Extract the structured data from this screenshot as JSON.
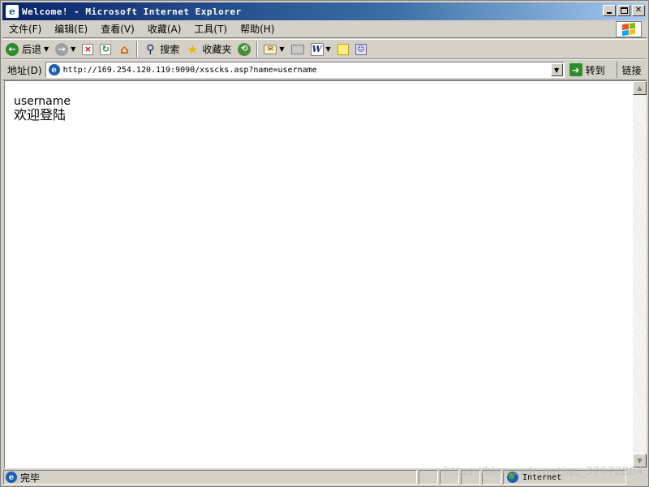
{
  "window": {
    "title": "Welcome! - Microsoft Internet Explorer"
  },
  "menu": {
    "items": [
      {
        "label": "文件(F)"
      },
      {
        "label": "编辑(E)"
      },
      {
        "label": "查看(V)"
      },
      {
        "label": "收藏(A)"
      },
      {
        "label": "工具(T)"
      },
      {
        "label": "帮助(H)"
      }
    ]
  },
  "toolbar": {
    "back_label": "后退",
    "search_label": "搜索",
    "favorites_label": "收藏夹",
    "icons": {
      "back": "←",
      "forward": "→",
      "stop": "×",
      "refresh": "↻",
      "home": "⌂",
      "search": "⚲",
      "favorites": "★",
      "history": "⟲",
      "mail": "✉",
      "edit": "W",
      "messenger": "☺"
    }
  },
  "address": {
    "label": "地址(D)",
    "url": "http://169.254.120.119:9090/xsscks.asp?name=username",
    "go_label": "转到",
    "links_label": "链接"
  },
  "page": {
    "line1": "username",
    "line2": "欢迎登陆"
  },
  "status": {
    "text": "完毕",
    "zone": "Internet"
  },
  "watermark": "https://blog.csdn.net/qq_37672864"
}
